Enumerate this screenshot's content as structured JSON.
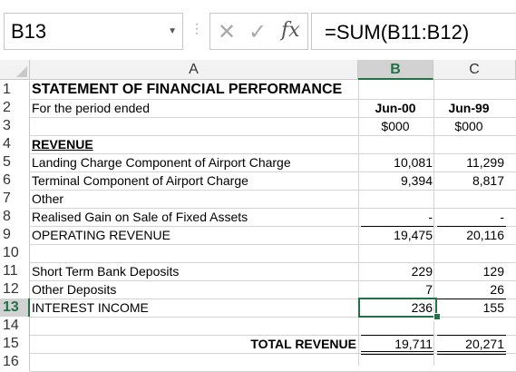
{
  "name_box": {
    "value": "B13"
  },
  "formula_bar": {
    "formula": "=SUM(B11:B12)",
    "cancel_icon": "✕",
    "enter_icon": "✓",
    "fx_icon": "fx"
  },
  "columns": [
    {
      "label": "A",
      "selected": false
    },
    {
      "label": "B",
      "selected": true
    },
    {
      "label": "C",
      "selected": false
    }
  ],
  "rows": [
    {
      "num": "1",
      "a": "STATEMENT OF FINANCIAL PERFORMANCE",
      "b": "",
      "c": ""
    },
    {
      "num": "2",
      "a": "For the period ended",
      "b": "Jun-00",
      "c": "Jun-99"
    },
    {
      "num": "3",
      "a": "",
      "b": "$000",
      "c": "$000"
    },
    {
      "num": "4",
      "a": "REVENUE",
      "b": "",
      "c": ""
    },
    {
      "num": "5",
      "a": "Landing Charge Component of Airport Charge",
      "b": "10,081",
      "c": "11,299"
    },
    {
      "num": "6",
      "a": "Terminal Component of Airport Charge",
      "b": "9,394",
      "c": "8,817"
    },
    {
      "num": "7",
      "a": "Other",
      "b": "",
      "c": ""
    },
    {
      "num": "8",
      "a": "Realised Gain on Sale of Fixed Assets",
      "b": "-",
      "c": "-"
    },
    {
      "num": "9",
      "a": "OPERATING REVENUE",
      "b": "19,475",
      "c": "20,116"
    },
    {
      "num": "10",
      "a": "",
      "b": "",
      "c": ""
    },
    {
      "num": "11",
      "a": "Short Term Bank Deposits",
      "b": "229",
      "c": "129"
    },
    {
      "num": "12",
      "a": "Other Deposits",
      "b": "7",
      "c": "26"
    },
    {
      "num": "13",
      "a": "INTEREST INCOME",
      "b": "236",
      "c": "155"
    },
    {
      "num": "14",
      "a": "",
      "b": "",
      "c": ""
    },
    {
      "num": "15",
      "a": "TOTAL REVENUE",
      "b": "19,711",
      "c": "20,271"
    },
    {
      "num": "16",
      "a": "",
      "b": "",
      "c": ""
    }
  ],
  "selected_row": "13",
  "accent_color": "#217346"
}
